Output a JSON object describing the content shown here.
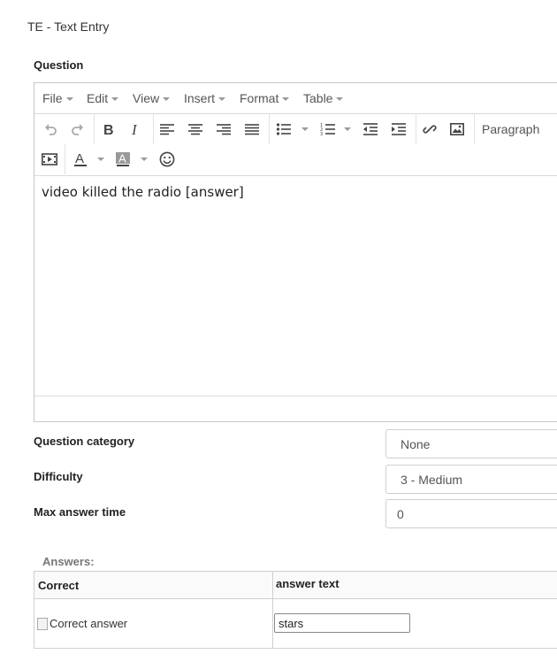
{
  "page": {
    "title": "TE - Text Entry"
  },
  "question": {
    "label": "Question",
    "editor": {
      "menus": [
        {
          "label": "File"
        },
        {
          "label": "Edit"
        },
        {
          "label": "View"
        },
        {
          "label": "Insert"
        },
        {
          "label": "Format"
        },
        {
          "label": "Table"
        }
      ],
      "block_format": "Paragraph",
      "content": "video killed the radio [answer]"
    }
  },
  "category": {
    "label": "Question category",
    "value": "None"
  },
  "difficulty": {
    "label": "Difficulty",
    "value": "3 - Medium"
  },
  "max_time": {
    "label": "Max answer time",
    "value": "0"
  },
  "answers": {
    "title": "Answers:",
    "columns": {
      "correct": "Correct",
      "text": "answer text"
    },
    "rows": [
      {
        "correct_alt": "Correct answer",
        "text": "stars"
      }
    ]
  },
  "icons": {
    "undo": "undo-icon",
    "redo": "redo-icon",
    "bold": "bold-icon",
    "italic": "italic-icon",
    "align_left": "align-left-icon",
    "align_center": "align-center-icon",
    "align_right": "align-right-icon",
    "justify": "justify-icon",
    "bullet_list": "bullet-list-icon",
    "numbered_list": "numbered-list-icon",
    "outdent": "outdent-icon",
    "indent": "indent-icon",
    "link": "link-icon",
    "image": "image-icon",
    "media": "media-icon",
    "text_color": "text-color-icon",
    "bg_color": "background-color-icon",
    "emoticon": "emoticon-icon"
  }
}
